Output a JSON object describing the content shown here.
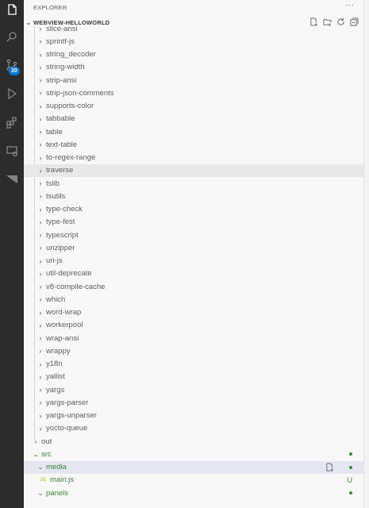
{
  "explorer": {
    "title": "EXPLORER",
    "more": "···",
    "project": "WEBVIEW-HELLOWORLD"
  },
  "activity": {
    "badge": "20"
  },
  "tree": {
    "packages": [
      "slice-ansi",
      "sprintf-js",
      "string_decoder",
      "string-width",
      "strip-ansi",
      "strip-json-comments",
      "supports-color",
      "tabbable",
      "table",
      "text-table",
      "to-regex-range",
      "traverse",
      "tslib",
      "tsutils",
      "type-check",
      "type-fest",
      "typescript",
      "unzipper",
      "uri-js",
      "util-deprecate",
      "v8-compile-cache",
      "which",
      "word-wrap",
      "workerpool",
      "wrap-ansi",
      "wrappy",
      "y18n",
      "yallist",
      "yargs",
      "yargs-parser",
      "yargs-unparser",
      "yocto-queue"
    ],
    "out": "out",
    "src": "src",
    "media": "media",
    "main_js": "main.js",
    "js_badge": "JS",
    "main_js_status": "U",
    "panels": "panels"
  },
  "colors": {
    "activity_bar": "#2c2c2c",
    "sidebar": "#f8f8f8",
    "git_untracked": "#388a34",
    "selection": "#e4e6f1",
    "badge": "#0078d4"
  }
}
